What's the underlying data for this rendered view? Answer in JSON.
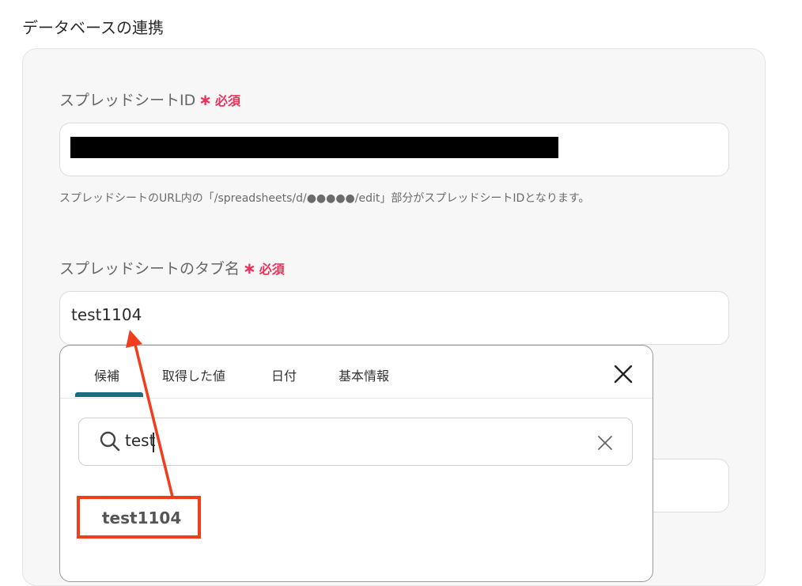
{
  "section_title": "データベースの連携",
  "spreadsheet_id_field": {
    "label": "スプレッドシートID",
    "required_mark": "∗",
    "required_text": "必須",
    "hint": "スプレッドシートのURL内の「/spreadsheets/d/●●●●●/edit」部分がスプレッドシートIDとなります。"
  },
  "tab_name_field": {
    "label": "スプレッドシートのタブ名",
    "required_mark": "∗",
    "required_text": "必須",
    "value": "test1104"
  },
  "dropdown": {
    "tabs": [
      "候補",
      "取得した値",
      "日付",
      "基本情報"
    ],
    "active_tab": "候補",
    "search_value": "test",
    "options": [
      "test1104"
    ]
  },
  "colors": {
    "required": "#e8345b",
    "active_tab_underline": "#1c6b80",
    "annotation": "#f23d1c"
  },
  "icons": [
    "close-icon",
    "search-icon",
    "clear-icon"
  ]
}
